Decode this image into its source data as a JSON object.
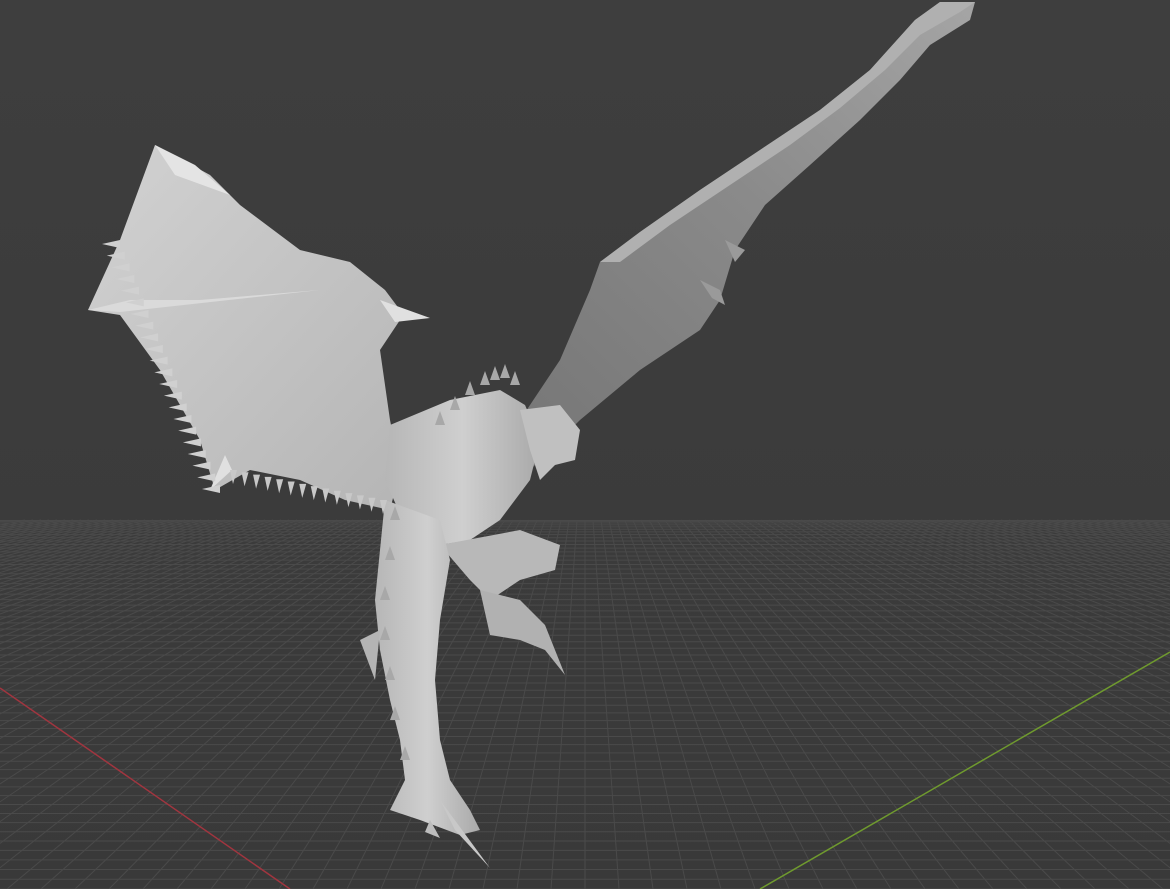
{
  "viewport": {
    "mode": "3d-viewport",
    "background_color": "#3a3a3a",
    "grid_color": "#4a4a4a",
    "x_axis_color": "#a1353f",
    "y_axis_color": "#6f9a2e",
    "object": {
      "name_icon": "dragon-mesh",
      "material_color": "#c4c4c4",
      "shadow_color": "#8e8e8e"
    }
  }
}
